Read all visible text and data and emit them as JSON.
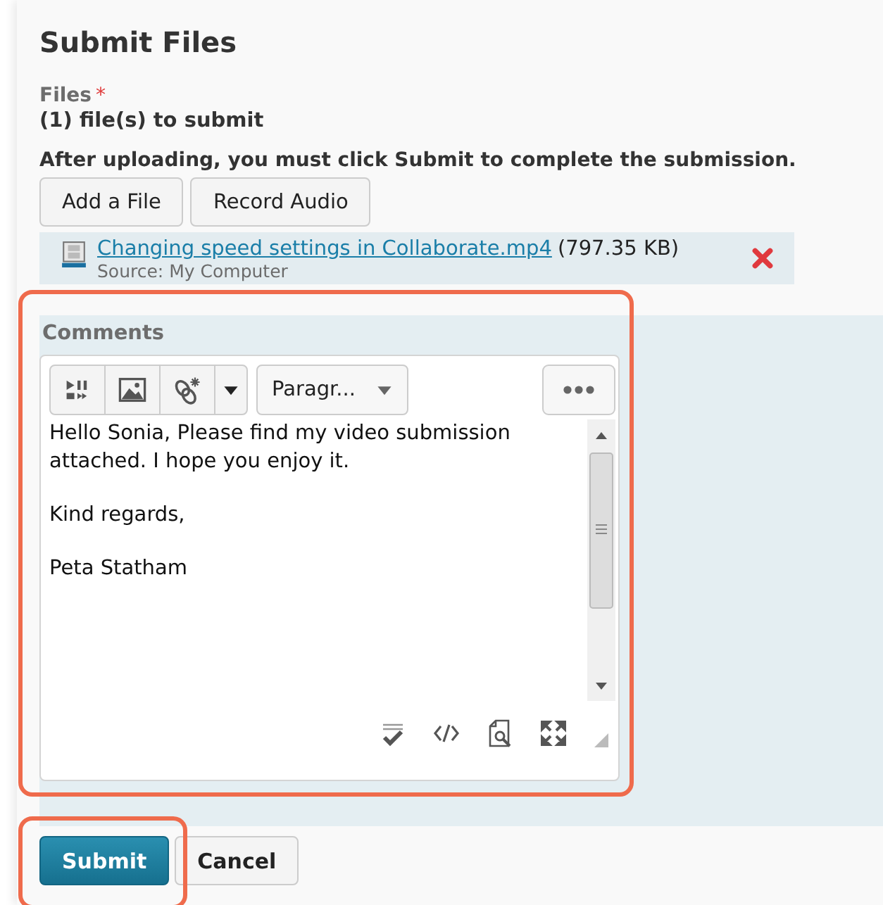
{
  "title": "Submit Files",
  "files_label": "Files",
  "required_mark": "*",
  "file_count": "(1) file(s) to submit",
  "instruction": "After uploading, you must click Submit to complete the submission.",
  "upload_buttons": [
    "Add a File",
    "Record Audio"
  ],
  "attachment": {
    "name": "Changing speed settings in Collaborate.mp4",
    "size": "(797.35 KB)",
    "source": "Source: My Computer"
  },
  "comments": {
    "label": "Comments",
    "format": "Paragr...",
    "paragraphs": [
      "Hello Sonia, Please find my video submission attached. I hope you enjoy it.",
      "Kind regards,",
      "Peta Statham"
    ]
  },
  "actions": [
    {
      "label": "Submit",
      "kind": "primary"
    },
    {
      "label": "Cancel",
      "kind": "secondary"
    }
  ]
}
